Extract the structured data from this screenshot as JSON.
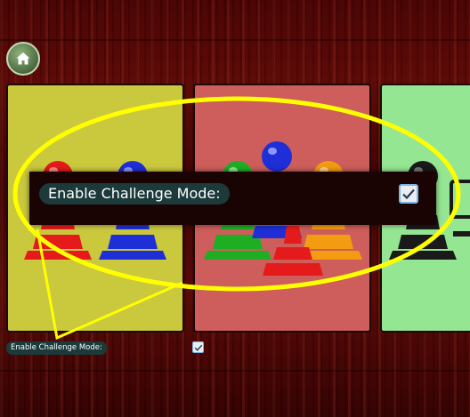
{
  "home_button": {
    "icon": "home-icon"
  },
  "game_cards": [
    {
      "name": "yellow-card",
      "color": "#cac93e",
      "pieces": [
        "red",
        "blue"
      ]
    },
    {
      "name": "red-card",
      "color": "#cd5e5b",
      "pieces": [
        "green",
        "blue",
        "orange",
        "red"
      ]
    },
    {
      "name": "green-card",
      "color": "#95e693",
      "pieces": [
        "black"
      ]
    }
  ],
  "challenge_popup": {
    "label": "Enable Challenge Mode:",
    "checked": true
  },
  "challenge_setting": {
    "label": "Enable Challenge Mode:",
    "checked": true
  },
  "annotation": {
    "color": "#ffff00"
  }
}
